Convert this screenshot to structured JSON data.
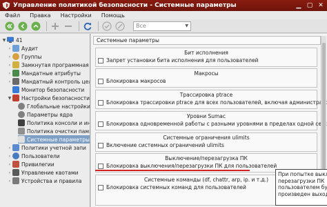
{
  "window": {
    "title": "Управление политикой безопасности - Системные параметры"
  },
  "menu": {
    "items": [
      "Файл",
      "Правка",
      "Настройки",
      "Помощь"
    ]
  },
  "toolbar": {
    "combo_value": "Все"
  },
  "tree": {
    "root": "41",
    "items": [
      {
        "label": "Аудит"
      },
      {
        "label": "Группы"
      },
      {
        "label": "Замкнутая программная с..."
      },
      {
        "label": "Мандатные атрибуты"
      },
      {
        "label": "Мандатный контроль цело..."
      },
      {
        "label": "Монитор безопасности"
      },
      {
        "label": "Настройки безопасности"
      },
      {
        "label": "Глобальные настройки ..."
      },
      {
        "label": "Параметры ядра"
      },
      {
        "label": "Политика консоли и ин..."
      },
      {
        "label": "Политика очистки памя..."
      },
      {
        "label": "Системные параметры"
      },
      {
        "label": "Политики учетной запи"
      },
      {
        "label": "Пользователи"
      },
      {
        "label": "Привилегии"
      },
      {
        "label": "Управление квотами"
      },
      {
        "label": "Устройства и правила"
      }
    ]
  },
  "panel": {
    "header": "Системные параметры",
    "groups": [
      {
        "title": "Бит исполнения",
        "option": "Запрет установки бита исполнения для пользователей"
      },
      {
        "title": "Макросы",
        "option": "Блокировка макросов"
      },
      {
        "title": "Трассировка ptrace",
        "option": "Блокировка трассировки ptrace для всех пользователей, включая администраторов"
      },
      {
        "title": "Уровни Sumac",
        "option": "Блокировка одновременной работы с разными уровнями в пределах одной сессии"
      },
      {
        "title": "Системные ограничения ulimits",
        "option": "Включение системных ограничений ulimits"
      },
      {
        "title": "Выключение/перезагрузка ПК",
        "option": "Блокировка выключения/перезагрузки ПК для пользователей"
      },
      {
        "title": "Системные команды (df, chattr, arp, ip. и т.д.)",
        "option": "Блокировка системных команд для пользователей"
      }
    ]
  },
  "tooltip": {
    "lines": [
      "При попытке выключ",
      "перезагрузки ПК",
      "пользователем будет",
      "произведен выход из"
    ]
  },
  "colors": {
    "titlebar": "#7a1a10",
    "selection": "#7d9fc6",
    "highlight_line": "#d42020"
  }
}
